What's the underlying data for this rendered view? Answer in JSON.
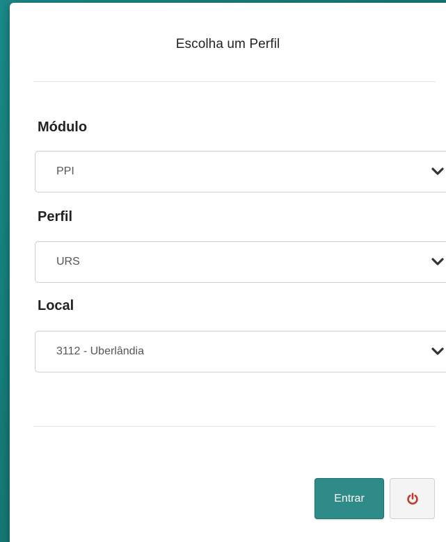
{
  "modal": {
    "title": "Escolha um Perfil"
  },
  "fields": {
    "modulo": {
      "label": "Módulo",
      "value": "PPI"
    },
    "perfil": {
      "label": "Perfil",
      "value": "URS"
    },
    "local": {
      "label": "Local",
      "value": "3112 - Uberlândia"
    }
  },
  "actions": {
    "enter_label": "Entrar",
    "power_icon": "power-icon"
  },
  "colors": {
    "background": "#17807d",
    "primary_button": "#2e8b87",
    "power_icon": "#c0392b",
    "chevron": "#333333"
  }
}
